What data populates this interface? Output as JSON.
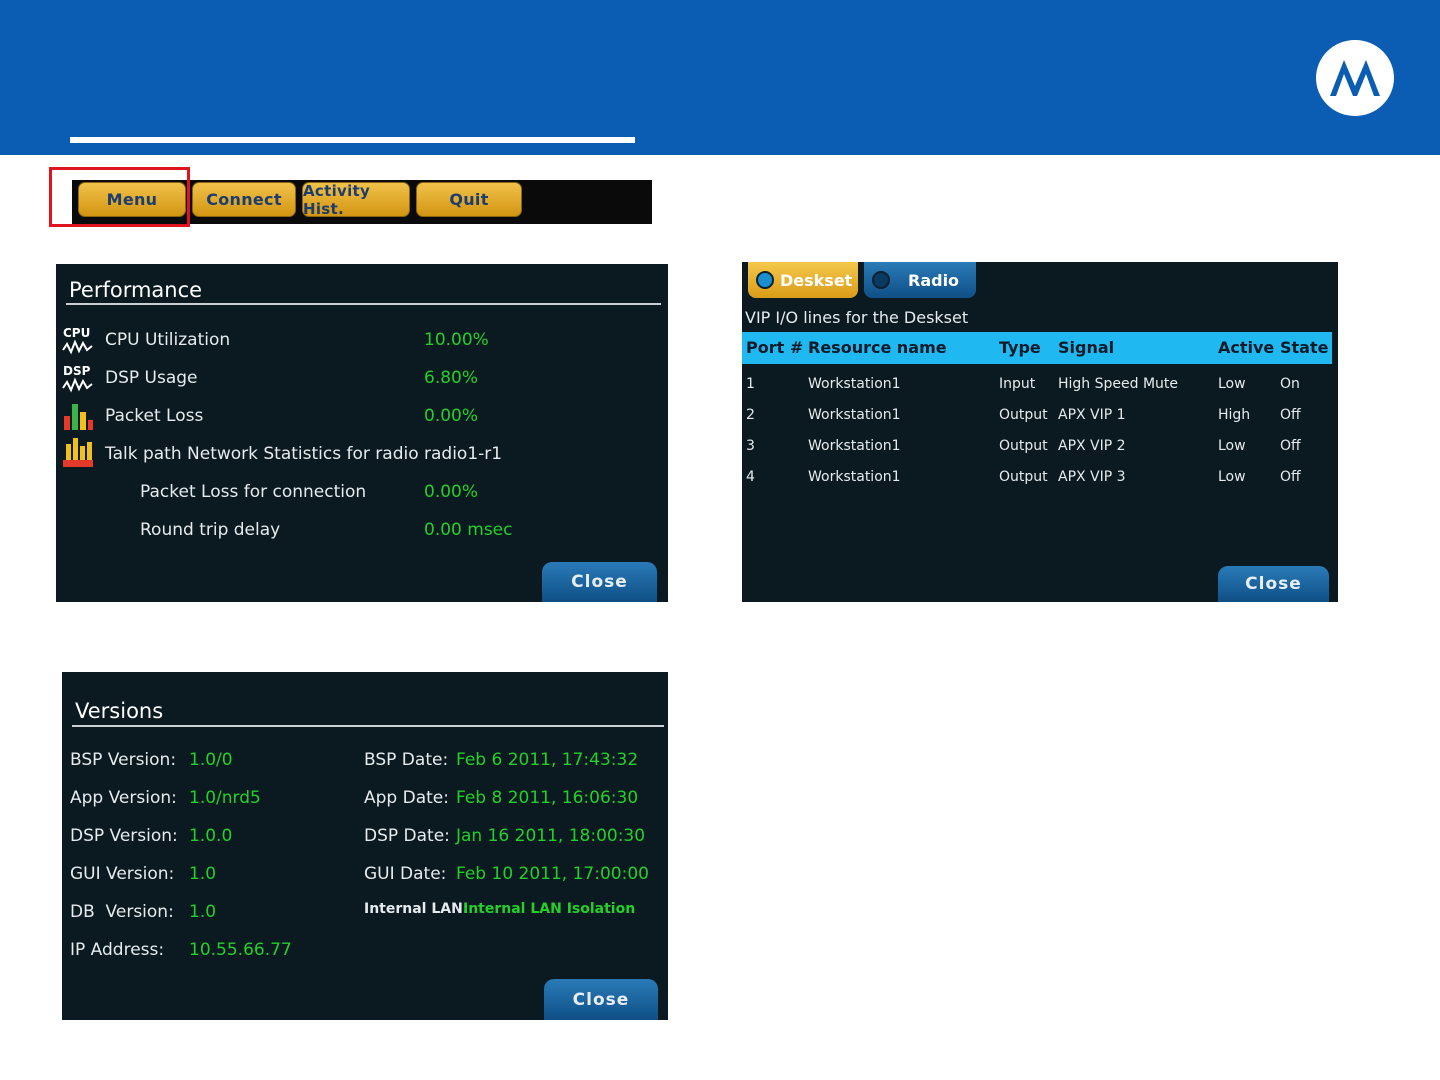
{
  "colors": {
    "header_blue": "#0b5cb3",
    "panel_bg": "#0b1a20",
    "value_green": "#22d02a",
    "button_gold": "#f0c24a",
    "table_header_cyan": "#1fb8f0",
    "highlight_red": "#e0141e"
  },
  "toolbar": {
    "buttons": [
      "Menu",
      "Connect",
      "Activity Hist.",
      "Quit"
    ]
  },
  "performance": {
    "title": "Performance",
    "icons": {
      "cpu": "CPU",
      "dsp": "DSP"
    },
    "rows": [
      {
        "icon": "cpu-icon",
        "label": "CPU Utilization",
        "value": "10.00%"
      },
      {
        "icon": "dsp-icon",
        "label": "DSP Usage",
        "value": "6.80%"
      },
      {
        "icon": "bar-chart-icon",
        "label": "Packet Loss",
        "value": "0.00%"
      },
      {
        "icon": "radio-stats-icon",
        "label": "Talk path Network Statistics for radio",
        "value": "radio1-r1"
      },
      {
        "icon": "",
        "label": "Packet Loss for connection",
        "value": "0.00%"
      },
      {
        "icon": "",
        "label": "Round trip delay",
        "value": "0.00 msec"
      }
    ],
    "close": "Close"
  },
  "vip": {
    "tabs": [
      "Deskset",
      "Radio"
    ],
    "subtitle": "VIP I/O lines for the Deskset",
    "columns": [
      "Port #",
      "Resource name",
      "Type",
      "Signal",
      "Active",
      "State"
    ],
    "rows": [
      [
        "1",
        "Workstation1",
        "Input",
        "High Speed Mute",
        "Low",
        "On"
      ],
      [
        "2",
        "Workstation1",
        "Output",
        "APX VIP 1",
        "High",
        "Off"
      ],
      [
        "3",
        "Workstation1",
        "Output",
        "APX VIP 2",
        "Low",
        "Off"
      ],
      [
        "4",
        "Workstation1",
        "Output",
        "APX VIP 3",
        "Low",
        "Off"
      ]
    ],
    "close": "Close"
  },
  "versions": {
    "title": "Versions",
    "left": [
      {
        "label": "BSP Version:",
        "value": "1.0/0"
      },
      {
        "label": "App Version:",
        "value": "1.0/nrd5"
      },
      {
        "label": "DSP Version:",
        "value": "1.0.0"
      },
      {
        "label": "GUI Version:",
        "value": "1.0"
      },
      {
        "label": "DB  Version:",
        "value": "1.0"
      },
      {
        "label": "IP Address:",
        "value": "10.55.66.77"
      }
    ],
    "right": [
      {
        "label": "BSP Date:",
        "value": "Feb 6 2011, 17:43:32"
      },
      {
        "label": "App Date:",
        "value": "Feb 8 2011, 16:06:30"
      },
      {
        "label": "DSP Date:",
        "value": "Jan 16 2011, 18:00:30"
      },
      {
        "label": "GUI Date:",
        "value": "Feb 10 2011, 17:00:00"
      },
      {
        "label": "Internal LAN:",
        "value": "Internal LAN Isolation"
      }
    ],
    "close": "Close"
  }
}
